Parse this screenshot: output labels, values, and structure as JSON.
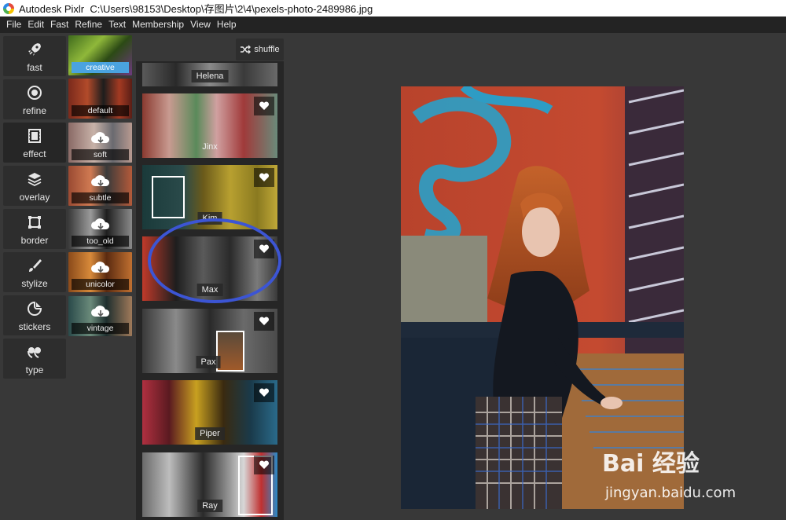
{
  "window": {
    "app_name": "Autodesk Pixlr",
    "file_path": "C:\\Users\\98153\\Desktop\\存图片\\2\\4\\pexels-photo-2489986.jpg"
  },
  "menu": [
    "File",
    "Edit",
    "Fast",
    "Refine",
    "Text",
    "Membership",
    "View",
    "Help"
  ],
  "categories": [
    {
      "label": "fast",
      "icon": "rocket-icon"
    },
    {
      "label": "refine",
      "icon": "refine-icon"
    },
    {
      "label": "effect",
      "icon": "film-icon"
    },
    {
      "label": "overlay",
      "icon": "layers-icon"
    },
    {
      "label": "border",
      "icon": "border-icon"
    },
    {
      "label": "stylize",
      "icon": "brush-icon"
    },
    {
      "label": "stickers",
      "icon": "sticker-icon"
    },
    {
      "label": "type",
      "icon": "quote-icon"
    }
  ],
  "presets": [
    {
      "label": "creative",
      "selected": true,
      "download": false
    },
    {
      "label": "default",
      "selected": false,
      "download": false
    },
    {
      "label": "soft",
      "selected": false,
      "download": true
    },
    {
      "label": "subtle",
      "selected": false,
      "download": true
    },
    {
      "label": "too_old",
      "selected": false,
      "download": true
    },
    {
      "label": "unicolor",
      "selected": false,
      "download": true
    },
    {
      "label": "vintage",
      "selected": false,
      "download": true
    }
  ],
  "shuffle_label": "shuffle",
  "effects": [
    {
      "label": "Helena",
      "favorite": false
    },
    {
      "label": "Jinx",
      "favorite": true
    },
    {
      "label": "Kim",
      "favorite": true
    },
    {
      "label": "Max",
      "favorite": true
    },
    {
      "label": "Pax",
      "favorite": true
    },
    {
      "label": "Piper",
      "favorite": true
    },
    {
      "label": "Ray",
      "favorite": true
    }
  ],
  "watermark": {
    "logo_text": "Bai 经验",
    "url": "jingyan.baidu.com"
  },
  "colors": {
    "accent": "#4aa3e0",
    "annotation": "#3c55d4",
    "panel": "#262626",
    "background": "#383838"
  }
}
